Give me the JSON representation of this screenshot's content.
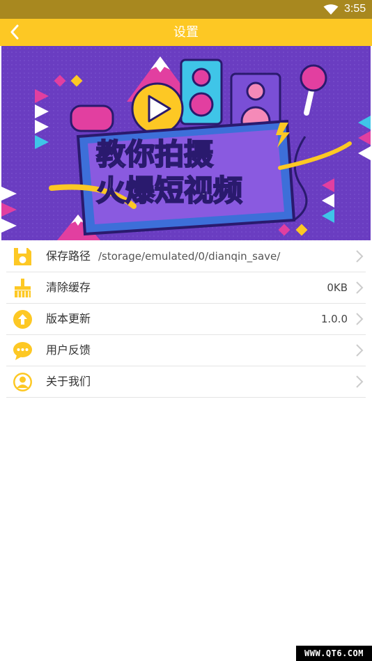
{
  "status_bar": {
    "time": "3:55",
    "wifi_icon": "wifi-icon",
    "background": "#a8881f"
  },
  "app_bar": {
    "title": "设置",
    "back_icon": "chevron-left-icon",
    "background": "#fdc824"
  },
  "banner": {
    "line1": "教你拍摄",
    "line2": "火爆短视频"
  },
  "settings": [
    {
      "label": "保存路径",
      "path": "/storage/emulated/0/dianqin_save/",
      "value": "",
      "icon": "save-icon"
    },
    {
      "label": "清除缓存",
      "value": "0KB",
      "icon": "broom-icon"
    },
    {
      "label": "版本更新",
      "value": "1.0.0",
      "icon": "upload-arrow-icon"
    },
    {
      "label": "用户反馈",
      "value": "",
      "icon": "chat-bubble-icon"
    },
    {
      "label": "关于我们",
      "value": "",
      "icon": "user-icon"
    }
  ],
  "watermark": "WWW.QT6.COM",
  "colors": {
    "accent": "#fdc824",
    "banner_bg": "#6a3dc1"
  }
}
